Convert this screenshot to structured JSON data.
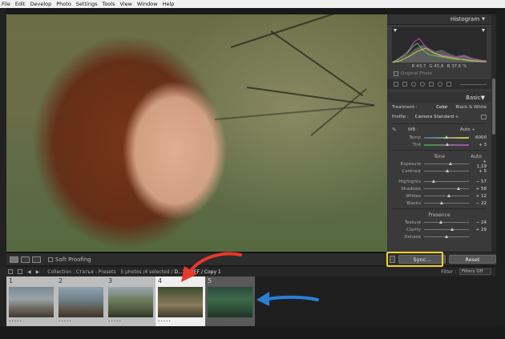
{
  "menu": [
    "File",
    "Edit",
    "Develop",
    "Photo",
    "Settings",
    "Tools",
    "View",
    "Window",
    "Help"
  ],
  "toolbar": {
    "soft_proofing_label": "Soft Proofing"
  },
  "histogram": {
    "title": "Histogram",
    "r_label": "R",
    "r_value": "43,7",
    "g_label": "G",
    "g_value": "45,6",
    "b_label": "B",
    "b_value": "37,6",
    "pct": "%",
    "original_photo_label": "Original Photo"
  },
  "basic": {
    "title": "Basic",
    "treatment_label": "Treatment :",
    "treatment_color": "Color",
    "treatment_bw": "Black & White",
    "profile_label": "Profile :",
    "profile_value": "Camera Standard ÷",
    "wb_label": "WB :",
    "wb_value": "Auto ÷",
    "tone_label": "Tone",
    "tone_auto": "Auto",
    "presence_label": "Presence",
    "sliders_wb": [
      {
        "label": "Temp",
        "value": "6000",
        "pos": 0.5,
        "kind": "temp"
      },
      {
        "label": "Tint",
        "value": "+ 3",
        "pos": 0.52,
        "kind": "tint"
      }
    ],
    "sliders_tone": [
      {
        "label": "Exposure",
        "value": "+ 1,19",
        "pos": 0.6
      },
      {
        "label": "Contrast",
        "value": "+ 5",
        "pos": 0.52
      }
    ],
    "sliders_tone2": [
      {
        "label": "Highlights",
        "value": "− 57",
        "pos": 0.22
      },
      {
        "label": "Shadows",
        "value": "+ 58",
        "pos": 0.78
      },
      {
        "label": "Whites",
        "value": "+ 12",
        "pos": 0.56
      },
      {
        "label": "Blacks",
        "value": "− 22",
        "pos": 0.4
      }
    ],
    "sliders_presence": [
      {
        "label": "Texture",
        "value": "− 24",
        "pos": 0.38
      },
      {
        "label": "Clarity",
        "value": "+ 29",
        "pos": 0.64
      },
      {
        "label": "Dehaze",
        "value": "",
        "pos": 0.5
      }
    ]
  },
  "sync_button": "Sync...",
  "reset_button": "Reset",
  "filmstrip_info": {
    "collection": "Collection : Статья - Presets",
    "count": "5 photos /4 selected /",
    "file": "D...20.NEF / Copy 1",
    "filter_label": "Filter :",
    "filter_value": "Filters Off"
  },
  "filmstrip": [
    {
      "num": "1",
      "state": "light"
    },
    {
      "num": "2",
      "state": "light"
    },
    {
      "num": "3",
      "state": "light"
    },
    {
      "num": "4",
      "state": "selected"
    },
    {
      "num": "5",
      "state": "dark"
    }
  ],
  "colors": {
    "highlight": "#f2d22a",
    "red_arrow": "#e8382a",
    "blue_arrow": "#2a7fd6"
  }
}
